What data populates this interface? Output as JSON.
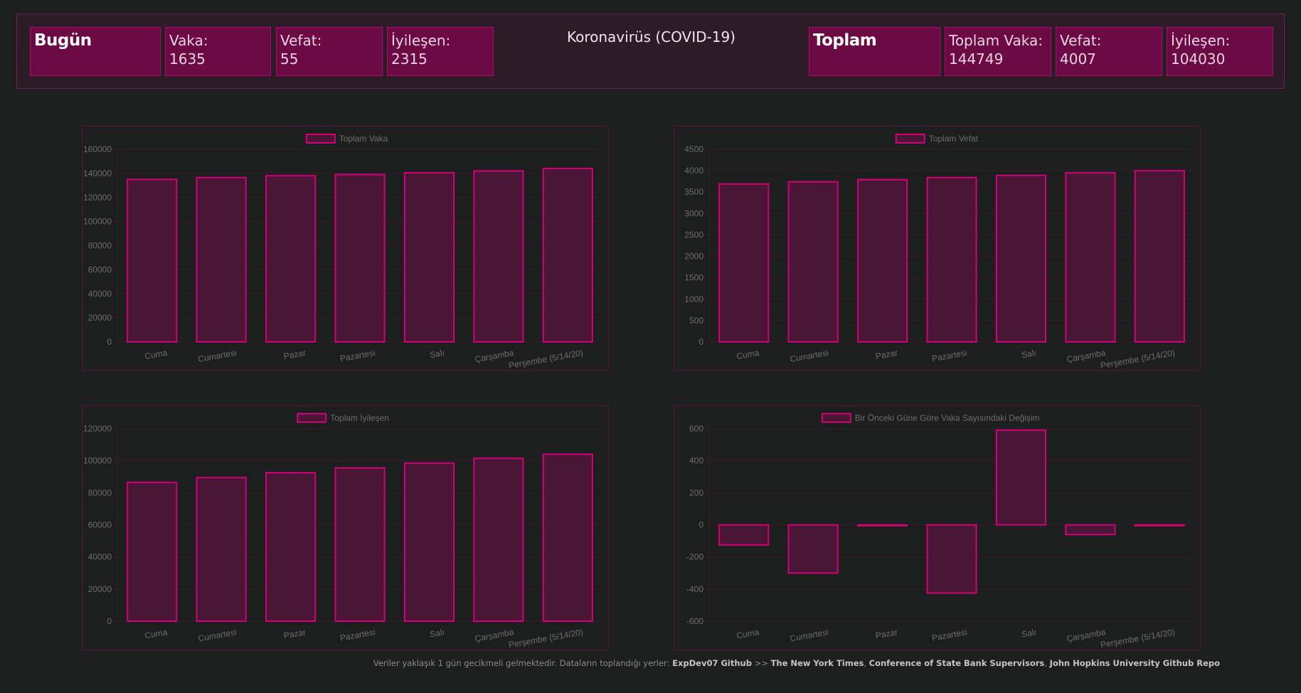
{
  "header": {
    "title": "Koronavirüs (COVID-19)",
    "today": {
      "heading": "Bugün",
      "cases_label": "Vaka:",
      "cases_value": "1635",
      "deaths_label": "Vefat:",
      "deaths_value": "55",
      "recovered_label": "İyileşen:",
      "recovered_value": "2315"
    },
    "total": {
      "heading": "Toplam",
      "cases_label": "Toplam Vaka:",
      "cases_value": "144749",
      "deaths_label": "Vefat:",
      "deaths_value": "4007",
      "recovered_label": "İyileşen:",
      "recovered_value": "104030"
    }
  },
  "colors": {
    "bar_stroke": "#d4007a",
    "bar_fill": "#4a1635",
    "grid": "#3a1a2e",
    "tick_text": "#6f6c6e"
  },
  "chart_data": [
    {
      "type": "bar",
      "legend": "Toplam Vaka",
      "categories": [
        "Cuma",
        "Cumartesi",
        "Pazar",
        "Pazartesi",
        "Salı",
        "Çarşamba",
        "Perşembe (5/14/20)"
      ],
      "values": [
        135000,
        136500,
        138000,
        139000,
        140500,
        142000,
        144000
      ],
      "ylim": [
        0,
        160000
      ],
      "yticks": [
        "160000",
        "140000",
        "120000",
        "100000",
        "80000",
        "60000",
        "40000",
        "20000",
        "0"
      ],
      "ytick_values": [
        160000,
        140000,
        120000,
        100000,
        80000,
        60000,
        40000,
        20000,
        0
      ]
    },
    {
      "type": "bar",
      "legend": "Toplam Vefat",
      "categories": [
        "Cuma",
        "Cumartesi",
        "Pazar",
        "Pazartesi",
        "Salı",
        "Çarşamba",
        "Perşembe (5/14/20)"
      ],
      "values": [
        3690,
        3740,
        3790,
        3840,
        3890,
        3950,
        4000
      ],
      "ylim": [
        0,
        4500
      ],
      "yticks": [
        "4500",
        "4000",
        "3500",
        "3000",
        "2500",
        "2000",
        "1500",
        "1000",
        "500",
        "0"
      ],
      "ytick_values": [
        4500,
        4000,
        3500,
        3000,
        2500,
        2000,
        1500,
        1000,
        500,
        0
      ]
    },
    {
      "type": "bar",
      "legend": "Toplam İyileşen",
      "categories": [
        "Cuma",
        "Cumartesi",
        "Pazar",
        "Pazartesi",
        "Salı",
        "Çarşamba",
        "Perşembe (5/14/20)"
      ],
      "values": [
        86500,
        89500,
        92500,
        95500,
        98500,
        101500,
        104000
      ],
      "ylim": [
        0,
        120000
      ],
      "yticks": [
        "120000",
        "100000",
        "80000",
        "60000",
        "40000",
        "20000",
        "0"
      ],
      "ytick_values": [
        120000,
        100000,
        80000,
        60000,
        40000,
        20000,
        0
      ]
    },
    {
      "type": "bar",
      "legend": "Bir Önceki Güne Göre Vaka Sayısındaki Değişim",
      "categories": [
        "Cuma",
        "Cumartesi",
        "Pazar",
        "Pazartesi",
        "Salı",
        "Çarşamba",
        "Perşembe (5/14/20)"
      ],
      "values": [
        -125,
        -300,
        -5,
        -425,
        590,
        -60,
        -5
      ],
      "ylim": [
        -600,
        600
      ],
      "yticks": [
        "600",
        "400",
        "200",
        "0",
        "-200",
        "-400",
        "-600"
      ],
      "ytick_values": [
        600,
        400,
        200,
        0,
        -200,
        -400,
        -600
      ]
    }
  ],
  "footer": {
    "text": "Veriler yaklaşık 1 gün gecikmeli gelmektedir.  Dataların toplandığı yerler:",
    "link1": "ExpDev07 Github",
    "sep": ">>",
    "link2": "The  New York Times",
    "comma1": ",",
    "link3": "Conference of State  Bank Supervisors",
    "comma2": ",",
    "link4": "John  Hopkins University Github  Repo"
  }
}
